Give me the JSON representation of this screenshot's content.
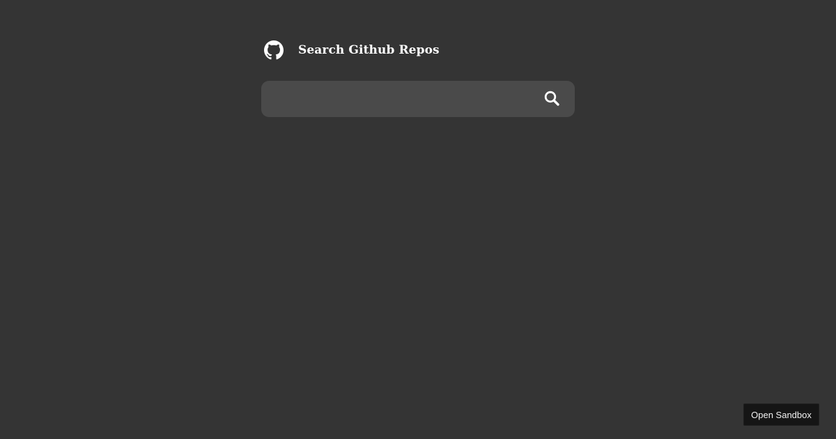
{
  "header": {
    "logo_icon": "github-icon",
    "title": "Search Github Repos"
  },
  "search": {
    "value": "",
    "placeholder": "",
    "button_icon": "search-icon"
  },
  "footer": {
    "sandbox_label": "Open Sandbox"
  },
  "colors": {
    "background": "#343434",
    "search_box": "#4a4a4a",
    "text": "#ffffff",
    "sandbox_button": "#151515"
  }
}
